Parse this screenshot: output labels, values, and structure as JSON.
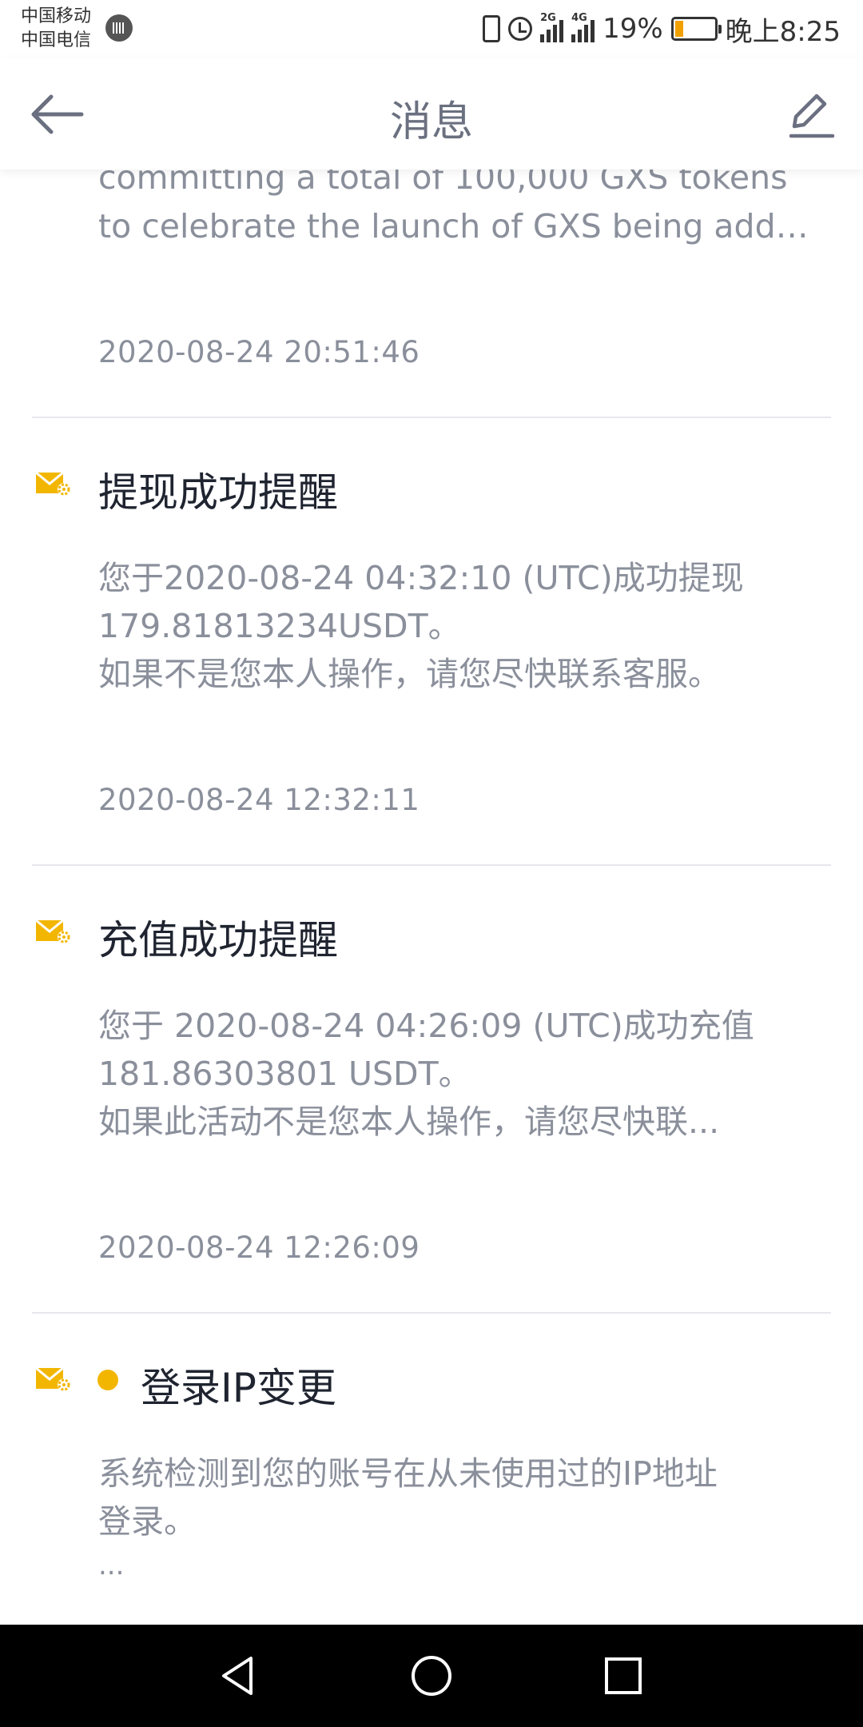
{
  "status_bar": {
    "carrier_1": "中国移动",
    "carrier_2": "中国电信",
    "network_1": "2G",
    "network_2": "4G",
    "battery_percent": "19%",
    "time": "晚上8:25",
    "icons": [
      "sound-wave-icon",
      "vibrate-icon",
      "alarm-icon",
      "signal-icon",
      "battery-icon"
    ]
  },
  "header": {
    "title": "消息",
    "back_icon": "arrow-left-icon",
    "edit_icon": "pencil-icon"
  },
  "colors": {
    "accent_yellow": "#F3B600",
    "title_text": "#1F2430",
    "secondary_text": "#8A8F9B",
    "header_title": "#6B7080",
    "divider": "#E7E8EC"
  },
  "partial_message": {
    "body_lines": [
      "committing a total of 100,000 GXS tokens",
      "to celebrate the launch of GXS being adde..."
    ],
    "timestamp": "2020-08-24 20:51:46"
  },
  "messages": [
    {
      "icon": "mail-gear-icon",
      "title": "提现成功提醒",
      "unread": false,
      "body_lines": [
        "您于2020-08-24 04:32:10 (UTC)成功提现",
        "179.81813234USDT。",
        "如果不是您本人操作，请您尽快联系客服。"
      ],
      "timestamp": "2020-08-24 12:32:11"
    },
    {
      "icon": "mail-gear-icon",
      "title": "充值成功提醒",
      "unread": false,
      "body_lines": [
        "您于 2020-08-24 04:26:09 (UTC)成功充值",
        "181.86303801 USDT。",
        "如果此活动不是您本人操作，请您尽快联..."
      ],
      "timestamp": "2020-08-24 12:26:09"
    },
    {
      "icon": "mail-gear-icon",
      "title": "登录IP变更",
      "unread": true,
      "body_lines": [
        "系统检测到您的账号在从未使用过的IP地址",
        "登录。",
        " ..."
      ]
    }
  ],
  "nav_bar": {
    "buttons": [
      "back-triangle-icon",
      "home-circle-icon",
      "recents-square-icon"
    ]
  }
}
